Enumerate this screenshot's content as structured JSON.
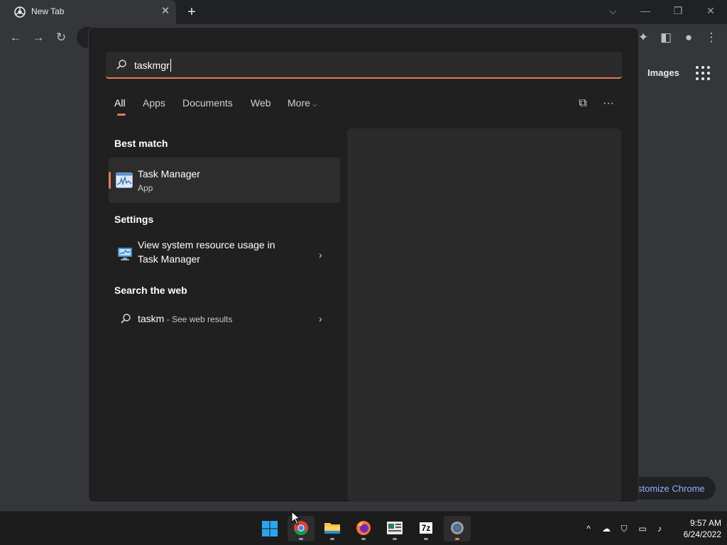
{
  "chrome": {
    "tab_title": "New Tab",
    "tab_close": "✕",
    "new_tab": "+",
    "images_link": "Images",
    "customize_label": "stomize Chrome"
  },
  "search": {
    "query": "taskmgr",
    "filters": {
      "all": "All",
      "apps": "Apps",
      "documents": "Documents",
      "web": "Web",
      "more": "More"
    },
    "best_match": {
      "heading": "Best match",
      "title": "Task Manager",
      "subtitle": "App"
    },
    "settings": {
      "heading": "Settings",
      "line1": "View system resource usage in",
      "line2": "Task Manager"
    },
    "web": {
      "heading": "Search the web",
      "term": "taskm",
      "hint": " - See web results"
    }
  },
  "taskbar": {
    "apps": [
      "start-icon",
      "chrome-icon",
      "file-explorer-icon",
      "firefox-icon",
      "news-icon",
      "7zip-icon",
      "settings-icon"
    ],
    "seven_zip_label": "7z",
    "time": "9:57 AM",
    "date": "6/24/2022"
  },
  "colors": {
    "accent": "#e67a5d",
    "panel": "#202020",
    "preview": "#2b2b2b",
    "taskbar": "#1c1c1c"
  }
}
